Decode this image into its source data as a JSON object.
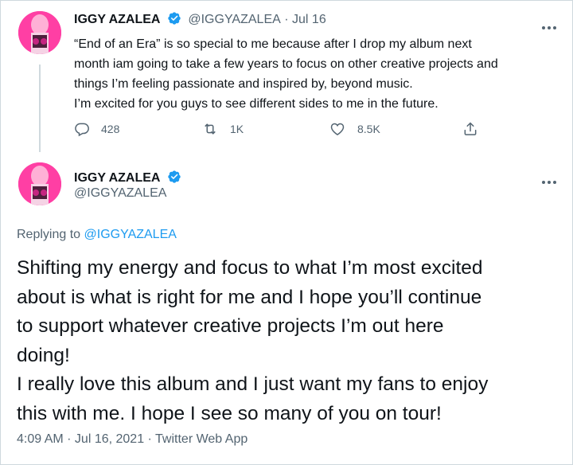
{
  "tweet1": {
    "name": "IGGY AZALEA",
    "handle": "@IGGYAZALEA",
    "separator": "·",
    "date": "Jul 16",
    "lines": [
      "“End of an Era” is so special to me because after I drop my album next",
      "month iam going to take a few years to focus on other creative projects and",
      "things I’m feeling passionate and inspired by, beyond music.",
      "I’m excited for you guys to see different sides to me in the future."
    ],
    "actions": {
      "replies": "428",
      "retweets": "1K",
      "likes": "8.5K"
    }
  },
  "tweet2": {
    "name": "IGGY AZALEA",
    "handle": "@IGGYAZALEA",
    "replying_prefix": "Replying to",
    "replying_to": "@IGGYAZALEA",
    "lines": [
      "Shifting my energy and focus to what I’m most excited",
      "about is what is right for me and I hope you’ll continue",
      "to support whatever creative projects I’m out here",
      "doing!",
      "I really love this album and I just want my fans to enjoy",
      "this with me. I hope I see so many of you on tour!"
    ],
    "meta": "4:09 AM · Jul 16, 2021 · Twitter Web App"
  },
  "colors": {
    "accent": "#1d9bf0",
    "text": "#0f1419",
    "muted": "#536471",
    "avatar_bg": "#ff3fa4"
  },
  "icons": [
    "verified-badge-icon",
    "more-icon",
    "reply-icon",
    "retweet-icon",
    "like-icon",
    "share-icon"
  ]
}
